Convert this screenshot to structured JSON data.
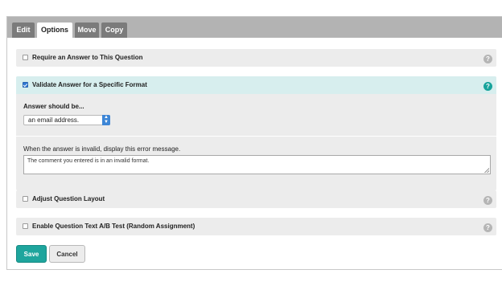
{
  "tabs": [
    {
      "label": "Edit",
      "active": false
    },
    {
      "label": "Options",
      "active": true
    },
    {
      "label": "Move",
      "active": false
    },
    {
      "label": "Copy",
      "active": false
    }
  ],
  "options": {
    "require_answer": {
      "label": "Require an Answer to This Question",
      "checked": false
    },
    "validate": {
      "label": "Validate Answer for a Specific Format",
      "checked": true,
      "answer_should_be_label": "Answer should be...",
      "format_selected": "an email address.",
      "error_prompt": "When the answer is invalid, display this error message.",
      "error_message": "The comment you entered is in an invalid format."
    },
    "adjust_layout": {
      "label": "Adjust Question Layout",
      "checked": false
    },
    "ab_test": {
      "label": "Enable Question Text A/B Test (Random Assignment)",
      "checked": false
    }
  },
  "help_glyph": "?",
  "buttons": {
    "save": "Save",
    "cancel": "Cancel"
  },
  "colors": {
    "accent": "#1ea59d",
    "checkbox": "#2f78d4",
    "validate_bg": "#d7eeee",
    "tab_active": "#ffffff",
    "tab_inactive": "#7b7b7b"
  }
}
